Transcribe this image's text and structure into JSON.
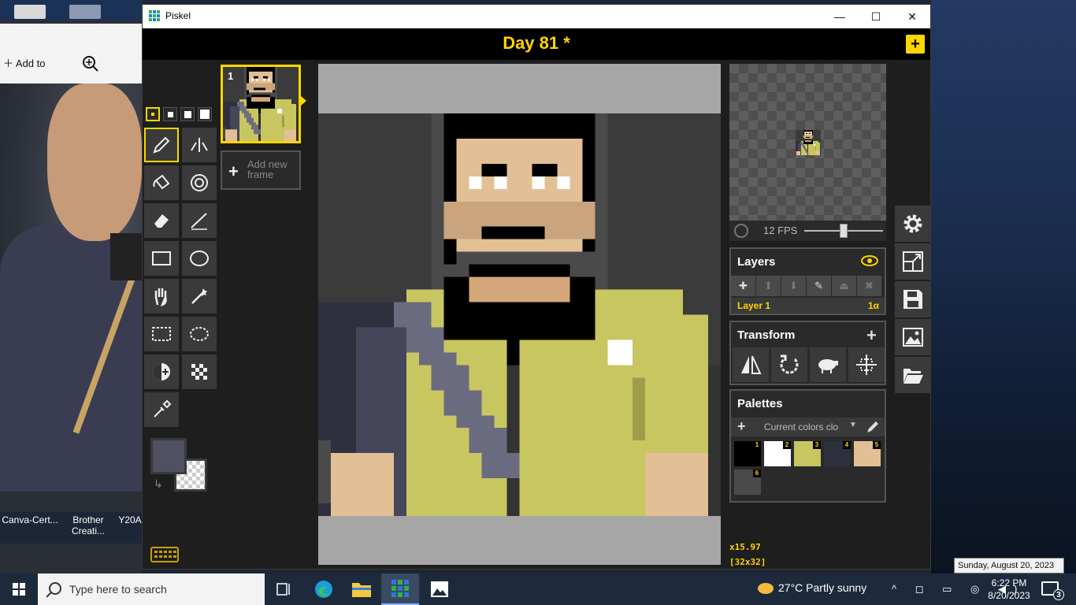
{
  "desktop": {
    "photo_toolbar": {
      "add_label": "Add to"
    },
    "files": [
      "Canva-Cert...",
      "Brother Creati...",
      "Y20A"
    ]
  },
  "window": {
    "title": "Piskel",
    "controls": {
      "minimize": "—",
      "maximize": "☐",
      "close": "✕"
    }
  },
  "header": {
    "title": "Day 81 *",
    "new_label": "+"
  },
  "frames": {
    "items": [
      {
        "number": "1"
      }
    ],
    "add_frame_label": "Add new frame"
  },
  "preview": {
    "fps_label": "12 FPS",
    "fps_value": 12
  },
  "layers": {
    "title": "Layers",
    "items": [
      {
        "name": "Layer 1",
        "opacity": "1α"
      }
    ]
  },
  "transform": {
    "title": "Transform"
  },
  "palettes": {
    "title": "Palettes",
    "current": "Current colors clo",
    "colors": [
      {
        "index": "1",
        "hex": "#000000"
      },
      {
        "index": "2",
        "hex": "#ffffff"
      },
      {
        "index": "3",
        "hex": "#c8c660"
      },
      {
        "index": "4",
        "hex": "#2f303e"
      },
      {
        "index": "5",
        "hex": "#e3bf95"
      },
      {
        "index": "6",
        "hex": "#4a4a4a"
      }
    ]
  },
  "colors": {
    "primary": "#4f5062",
    "secondary": "transparent"
  },
  "zoom": {
    "level": "x15.97",
    "size": "[32x32]"
  },
  "tooltip": {
    "date_full": "Sunday, August 20, 2023"
  },
  "taskbar": {
    "search_placeholder": "Type here to search",
    "weather": "27°C  Partly sunny",
    "time": "6:22 PM",
    "date": "8/20/2023",
    "notifications": "3"
  },
  "accent_color": "#ffd600"
}
